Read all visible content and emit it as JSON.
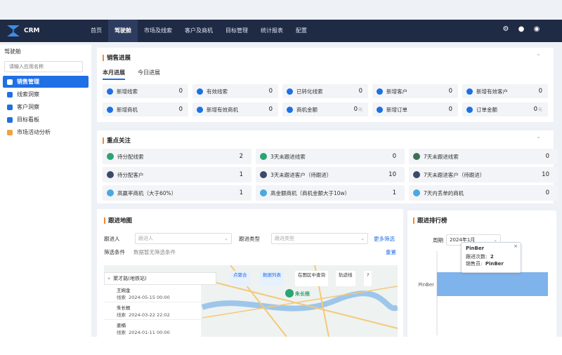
{
  "app": {
    "name": "CRM"
  },
  "nav": [
    "首页",
    "驾驶舱",
    "市场及线索",
    "客户及商机",
    "目标管理",
    "统计报表",
    "配置"
  ],
  "sidebar": {
    "title": "驾驶舱",
    "search_placeholder": "请输入应用名称",
    "items": [
      "销售管理",
      "线索洞察",
      "客户洞察",
      "目标看板",
      "市场活动分析"
    ]
  },
  "sales": {
    "title": "销售进展",
    "tabs": [
      "本月进展",
      "今日进展"
    ],
    "stats": [
      {
        "label": "新增线索",
        "value": "0",
        "unit": ""
      },
      {
        "label": "有效线索",
        "value": "0",
        "unit": ""
      },
      {
        "label": "已转化线索",
        "value": "0",
        "unit": ""
      },
      {
        "label": "新增客户",
        "value": "0",
        "unit": ""
      },
      {
        "label": "新增有效客户",
        "value": "0",
        "unit": ""
      },
      {
        "label": "新增商机",
        "value": "0",
        "unit": ""
      },
      {
        "label": "新增有效商机",
        "value": "0",
        "unit": ""
      },
      {
        "label": "商机金额",
        "value": "0",
        "unit": "元"
      },
      {
        "label": "新增订单",
        "value": "0",
        "unit": ""
      },
      {
        "label": "订单金额",
        "value": "0",
        "unit": "元"
      }
    ]
  },
  "focus": {
    "title": "重点关注",
    "items": [
      {
        "label": "待分配线索",
        "value": "2",
        "color": "#2ba471"
      },
      {
        "label": "3天未跟进线索",
        "value": "0",
        "color": "#2ba471"
      },
      {
        "label": "7天未跟进线索",
        "value": "0",
        "color": "#3f6f55"
      },
      {
        "label": "待分配客户",
        "value": "1",
        "color": "#3b4a6b"
      },
      {
        "label": "3天未跟进客户（待跟进）",
        "value": "10",
        "color": "#3b4a6b"
      },
      {
        "label": "7天未跟进客户（待跟进）",
        "value": "10",
        "color": "#3b4a6b"
      },
      {
        "label": "高赢率商机（大于60%）",
        "value": "1",
        "color": "#4aa8e0"
      },
      {
        "label": "高金额商机（商机金额大于10w）",
        "value": "1",
        "color": "#4aa8e0"
      },
      {
        "label": "7天内丢单的商机",
        "value": "0",
        "color": "#4aa8e0"
      }
    ]
  },
  "follow_map": {
    "title": "跟进地图",
    "follower_label": "跟进人",
    "follower_placeholder": "跟进人",
    "type_label": "跟进类型",
    "type_placeholder": "跟进类型",
    "more_filter": "更多筛选",
    "filter_label": "筛选条件",
    "filter_empty": "数据暂无筛选条件",
    "reset": "重置",
    "search_value": "聚才路(地铁站)",
    "btn_cluster": "点聚合",
    "btn_list": "数据列表",
    "btn_area": "在图区中查询",
    "btn_track": "轨迹线",
    "marker_label": "朱长根",
    "records": [
      {
        "name": "王婉金",
        "type": "线索",
        "time": "2024-05-15 00:00"
      },
      {
        "name": "朱长根",
        "type": "线索",
        "time": "2024-03-22 22:02"
      },
      {
        "name": "姜楠",
        "type": "线索",
        "time": "2024-01-11 00:00"
      }
    ]
  },
  "ranking": {
    "title": "跟进排行榜",
    "period_label": "周期",
    "period_value": "2024年1月",
    "tooltip": {
      "name": "PinBer",
      "count_label": "跟进次数:",
      "count": "2",
      "seller_label": "销售员:",
      "seller": "PinBer"
    },
    "chart_data": {
      "type": "bar",
      "orientation": "horizontal",
      "categories": [
        "PinBer"
      ],
      "values": [
        2
      ],
      "color": "#7fb3ec"
    }
  }
}
